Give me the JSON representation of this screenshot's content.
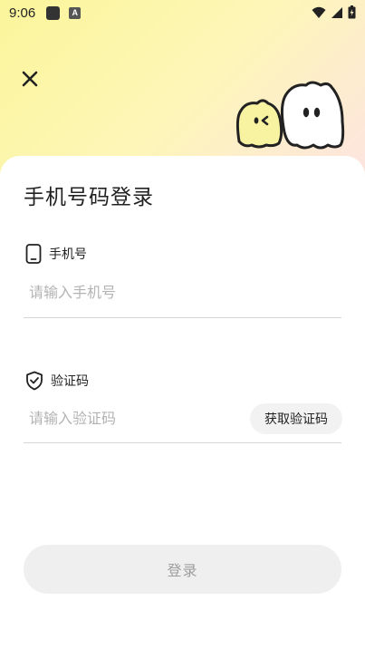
{
  "status_bar": {
    "time": "9:06",
    "notification_icons": [
      "app-square-icon",
      "a-letter-icon"
    ],
    "a_icon_glyph": "A",
    "right_icons": [
      "wifi-icon",
      "signal-icon",
      "battery-icon"
    ]
  },
  "header": {
    "close_icon": "close-icon",
    "mascot": "ghost-mascots-illustration"
  },
  "login": {
    "title": "手机号码登录",
    "phone": {
      "icon": "phone-icon",
      "label": "手机号",
      "placeholder": "请输入手机号",
      "value": ""
    },
    "code": {
      "icon": "shield-check-icon",
      "label": "验证码",
      "placeholder": "请输入验证码",
      "value": "",
      "get_code_label": "获取验证码"
    },
    "submit_label": "登录"
  },
  "colors": {
    "gradient_yellow": "#fbf59b",
    "gradient_pink": "#fbd3e6",
    "text_primary": "#222222",
    "placeholder": "#b3b3b3",
    "button_disabled_bg": "#efefef",
    "button_disabled_text": "#9e9e9e"
  }
}
